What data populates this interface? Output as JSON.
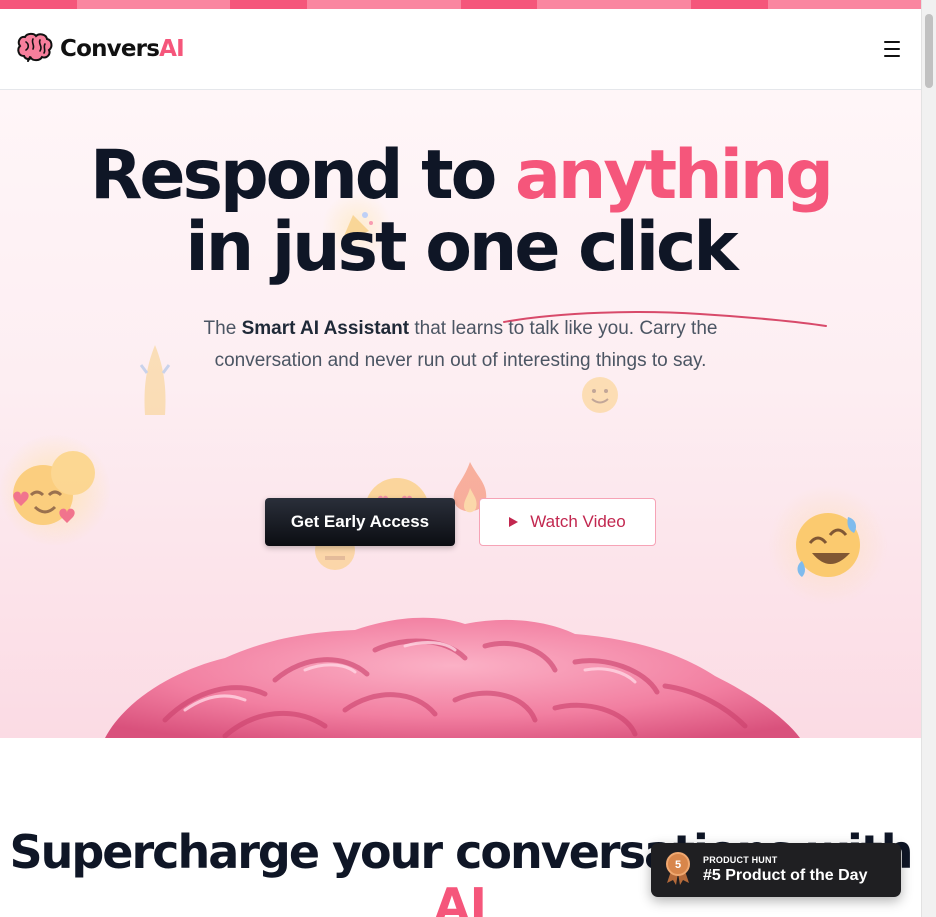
{
  "stripe_colors": [
    "#f5567b",
    "#fa86a0",
    "#f5567b",
    "#fa86a0",
    "#f5567b",
    "#fa86a0",
    "#f5567b",
    "#fa86a0"
  ],
  "header": {
    "logo_main": "Convers",
    "logo_accent": "AI",
    "menu_icon": "hamburger-menu-icon"
  },
  "hero": {
    "headline_part1": "Respond to ",
    "headline_accent": "anything",
    "headline_part2": "in just one click",
    "subtitle_pre": "The ",
    "subtitle_bold": "Smart AI Assistant",
    "subtitle_post": " that learns to talk like you. Carry the conversation and never run out of interesting things to say.",
    "primary_button": "Get Early Access",
    "secondary_button": "Watch Video",
    "secondary_button_icon": "play-icon",
    "emojis": [
      "party-emoji-icon",
      "praying-hands-emoji-icon",
      "smiling-face-hearts-emoji-icon",
      "blushing-emoji-icon",
      "heart-eyes-emoji-icon",
      "fire-emoji-icon",
      "smile-emoji-icon",
      "rolling-laughing-emoji-icon",
      "zipper-mouth-emoji-icon"
    ]
  },
  "section2": {
    "title": "Supercharge your conversations with",
    "title_accent": "AI"
  },
  "product_hunt": {
    "label": "PRODUCT HUNT",
    "rank_text": "#5 Product of the Day",
    "medal_number": "5"
  },
  "colors": {
    "accent": "#f5567b",
    "dark": "#0f1626",
    "secondary_button_text": "#c2274f"
  }
}
